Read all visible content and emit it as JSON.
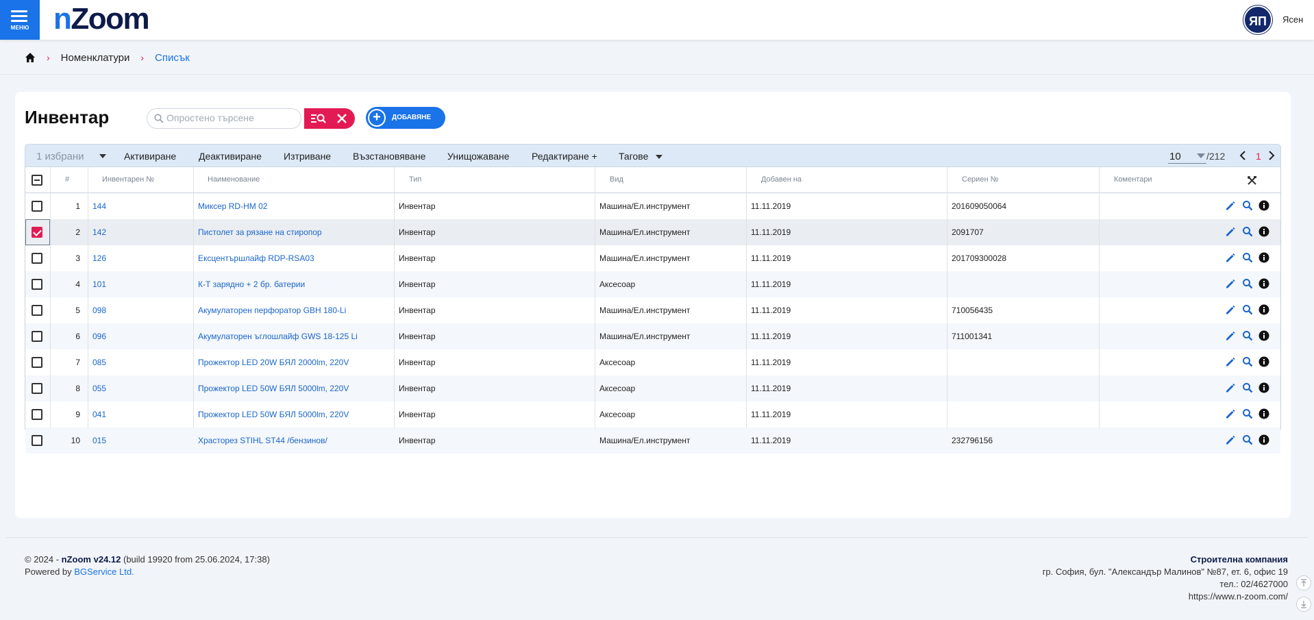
{
  "header": {
    "menu_label": "МЕНЮ",
    "logo_n": "n",
    "logo_rest": "Zoom",
    "avatar_initials": "ЯП",
    "user_name": "Ясен"
  },
  "breadcrumb": {
    "items": [
      "Номенклатури",
      "Списък"
    ]
  },
  "page": {
    "title": "Инвентар",
    "search_placeholder": "Опростено търсене",
    "add_label": "ДОБАВЯНЕ"
  },
  "toolbar": {
    "selected": "1 избрани",
    "actions": [
      "Активиране",
      "Деактивиране",
      "Изтриване",
      "Възстановяване",
      "Унищожаване",
      "Редактиране +",
      "Тагове"
    ],
    "per_page": "10",
    "total": "/212",
    "current_page": "1"
  },
  "table": {
    "columns": [
      "#",
      "Инвентарен №",
      "Наименование",
      "Тип",
      "Вид",
      "Добавен на",
      "Сериен №",
      "Коментари"
    ],
    "rows": [
      {
        "n": "1",
        "inv": "144",
        "name": "Миксер RD-HM 02",
        "type": "Инвентар",
        "kind": "Машина/Ел.инструмент",
        "date": "11.11.2019",
        "serial": "201609050064",
        "comment": "",
        "checked": false
      },
      {
        "n": "2",
        "inv": "142",
        "name": "Пистолет за рязане на стиропор",
        "type": "Инвентар",
        "kind": "Машина/Ел.инструмент",
        "date": "11.11.2019",
        "serial": "2091707",
        "comment": "",
        "checked": true
      },
      {
        "n": "3",
        "inv": "126",
        "name": "Ексцентършлайф RDP-RSA03",
        "type": "Инвентар",
        "kind": "Машина/Ел.инструмент",
        "date": "11.11.2019",
        "serial": "201709300028",
        "comment": "",
        "checked": false
      },
      {
        "n": "4",
        "inv": "101",
        "name": "К-Т зарядно + 2 бр. батерии",
        "type": "Инвентар",
        "kind": "Аксесоар",
        "date": "11.11.2019",
        "serial": "",
        "comment": "",
        "checked": false
      },
      {
        "n": "5",
        "inv": "098",
        "name": "Акумулаторен перфоратор GBH 180-Li",
        "type": "Инвентар",
        "kind": "Машина/Ел.инструмент",
        "date": "11.11.2019",
        "serial": "710056435",
        "comment": "",
        "checked": false
      },
      {
        "n": "6",
        "inv": "096",
        "name": "Акумулаторен ъглошлайф GWS 18-125 Li",
        "type": "Инвентар",
        "kind": "Машина/Ел.инструмент",
        "date": "11.11.2019",
        "serial": "711001341",
        "comment": "",
        "checked": false
      },
      {
        "n": "7",
        "inv": "085",
        "name": "Прожектор LED 20W БЯЛ 2000lm, 220V",
        "type": "Инвентар",
        "kind": "Аксесоар",
        "date": "11.11.2019",
        "serial": "",
        "comment": "",
        "checked": false
      },
      {
        "n": "8",
        "inv": "055",
        "name": "Прожектор LED 50W БЯЛ 5000lm, 220V",
        "type": "Инвентар",
        "kind": "Аксесоар",
        "date": "11.11.2019",
        "serial": "",
        "comment": "",
        "checked": false
      },
      {
        "n": "9",
        "inv": "041",
        "name": "Прожектор LED 50W БЯЛ 5000lm, 220V",
        "type": "Инвентар",
        "kind": "Аксесоар",
        "date": "11.11.2019",
        "serial": "",
        "comment": "",
        "checked": false
      },
      {
        "n": "10",
        "inv": "015",
        "name": "Храсторез STIHL ST44 /бензинов/",
        "type": "Инвентар",
        "kind": "Машина/Ел.инструмент",
        "date": "11.11.2019",
        "serial": "232796156",
        "comment": "",
        "checked": false
      }
    ]
  },
  "footer": {
    "copy_prefix": "© 2024 - ",
    "product": "nZoom v24.12",
    "build": " (build 19920 from 25.06.2024, 17:38)",
    "powered_prefix": "Powered by ",
    "powered_link": "BGService Ltd.",
    "company": "Строителна компания",
    "address": "гр. София, бул. \"Александър Малинов\" №87, ет. 6, офис 19",
    "phone": "тел.: 02/4627000",
    "website": "https://www.n-zoom.com/"
  },
  "colors": {
    "primary": "#1a73e8",
    "accent": "#e31b54",
    "logo_dark": "#0d1b4a"
  },
  "icons": {
    "menu": "hamburger-icon",
    "home": "home-icon",
    "search": "search-icon",
    "search_advanced": "list-search-icon",
    "clear": "close-icon",
    "add": "plus-icon",
    "settings": "tools-icon",
    "edit": "pencil-icon",
    "view": "magnifier-icon",
    "info": "info-icon"
  }
}
